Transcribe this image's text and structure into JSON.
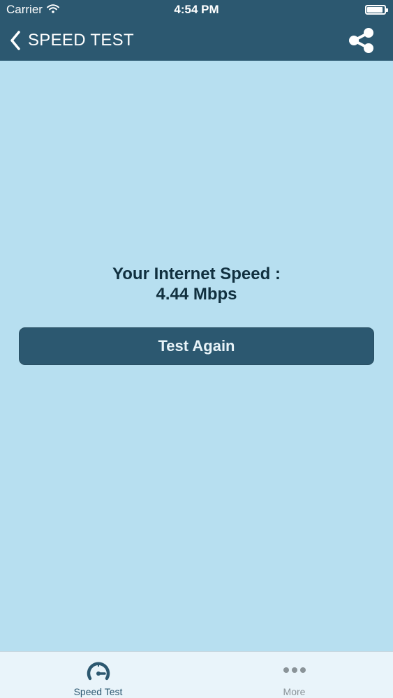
{
  "status_bar": {
    "carrier": "Carrier",
    "time": "4:54 PM",
    "wifi_icon": "wifi-icon",
    "battery_icon": "battery-icon"
  },
  "nav": {
    "title": "SPEED TEST",
    "back_icon": "chevron-left-icon",
    "share_icon": "share-icon"
  },
  "result": {
    "label": "Your Internet Speed :",
    "value": "4.44 Mbps"
  },
  "actions": {
    "test_again_label": "Test Again"
  },
  "tabs": [
    {
      "label": "Speed Test",
      "icon": "speedometer-icon",
      "selected": true
    },
    {
      "label": "More",
      "icon": "more-dots-icon",
      "selected": false
    }
  ],
  "colors": {
    "nav_background": "#2c5870",
    "page_background": "#b7dff0",
    "button_background": "#2c5870",
    "text_dark": "#11303f",
    "tab_selected": "#2c5870",
    "tab_unselected": "#8a9398"
  }
}
